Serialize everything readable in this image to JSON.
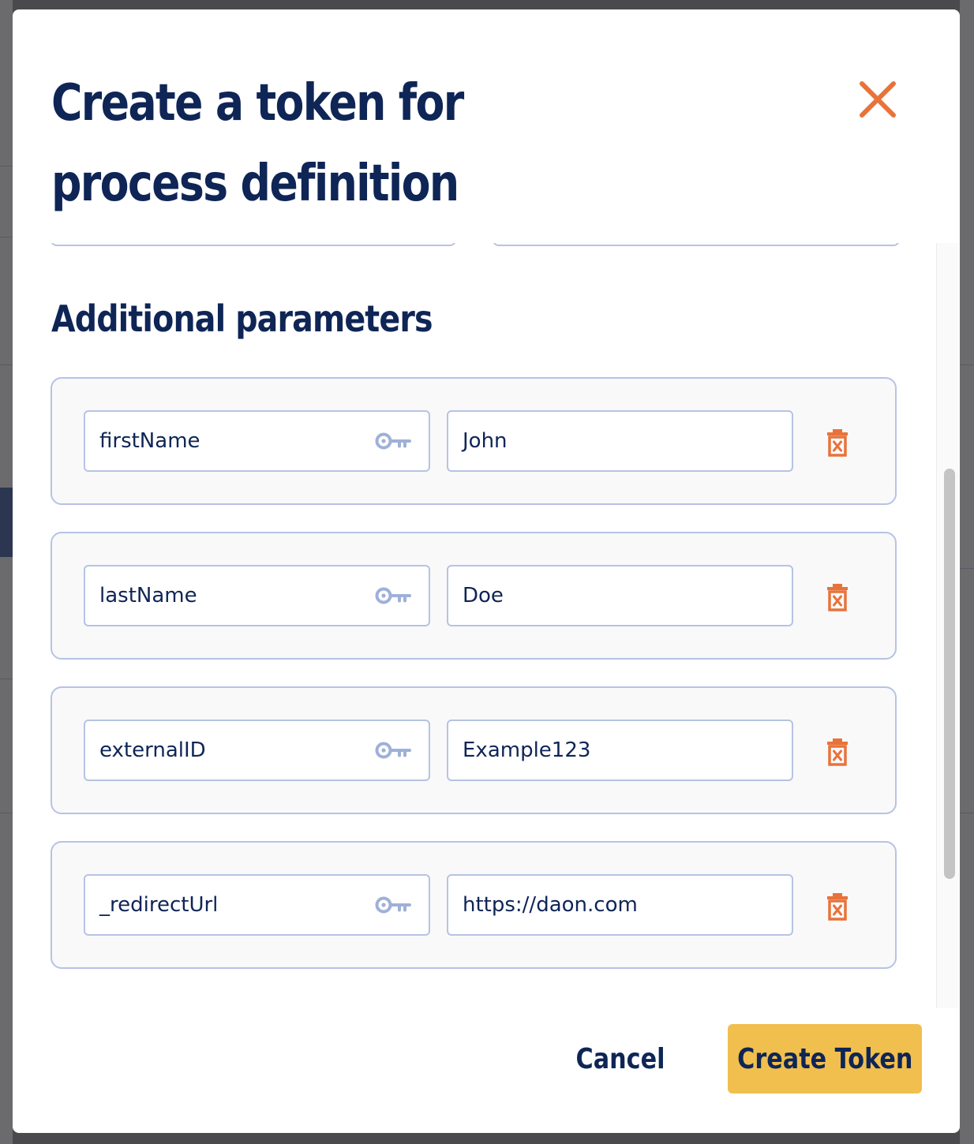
{
  "modal": {
    "title": "Create a token for process definition",
    "close_icon": "close-icon",
    "section_title": "Additional parameters",
    "parameters": [
      {
        "key": "firstName",
        "value": "John"
      },
      {
        "key": "lastName",
        "value": "Doe"
      },
      {
        "key": "externalID",
        "value": "Example123"
      },
      {
        "key": "_redirectUrl",
        "value": "https://daon.com"
      }
    ],
    "cancel_label": "Cancel",
    "create_label": "Create Token"
  },
  "colors": {
    "title": "#0e2556",
    "accent_close": "#e8733a",
    "border": "#b6c3e3",
    "key_icon": "#9fb0d8",
    "trash_icon": "#e8733a",
    "primary_button": "#f1bf4d"
  }
}
